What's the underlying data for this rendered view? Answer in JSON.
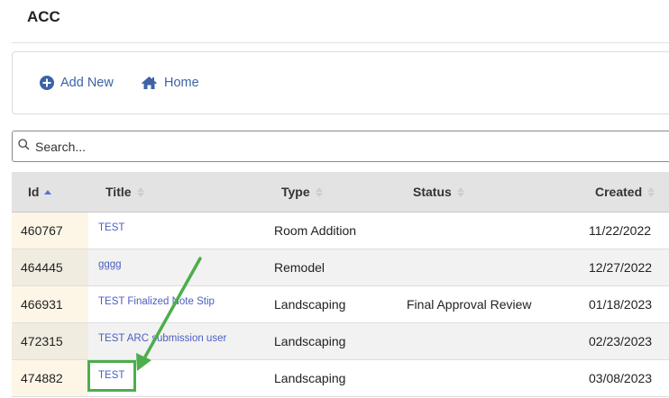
{
  "page": {
    "title": "ACC"
  },
  "toolbar": {
    "add_new_label": "Add New",
    "home_label": "Home",
    "accent_color": "#3c63a6"
  },
  "search": {
    "placeholder": "Search...",
    "value": ""
  },
  "table": {
    "columns": [
      {
        "label": "Id",
        "sort": "ascending"
      },
      {
        "label": "Title",
        "sort": "none"
      },
      {
        "label": "Type",
        "sort": "none"
      },
      {
        "label": "Status",
        "sort": "none"
      },
      {
        "label": "Created",
        "sort": "none"
      }
    ],
    "rows": [
      {
        "id": "460767",
        "title": "TEST",
        "type": "Room Addition",
        "status": "",
        "created": "11/22/2022"
      },
      {
        "id": "464445",
        "title": "gggg",
        "type": "Remodel",
        "status": "",
        "created": "12/27/2022"
      },
      {
        "id": "466931",
        "title": "TEST Finalized Note Stip",
        "type": "Landscaping",
        "status": "Final Approval Review",
        "created": "01/18/2023"
      },
      {
        "id": "472315",
        "title": "TEST ARC submission user",
        "type": "Landscaping",
        "status": "",
        "created": "02/23/2023"
      },
      {
        "id": "474882",
        "title": "TEST",
        "type": "Landscaping",
        "status": "",
        "created": "03/08/2023"
      }
    ]
  },
  "annotation": {
    "color": "#4cae4c",
    "highlighted_row_index": 4
  }
}
